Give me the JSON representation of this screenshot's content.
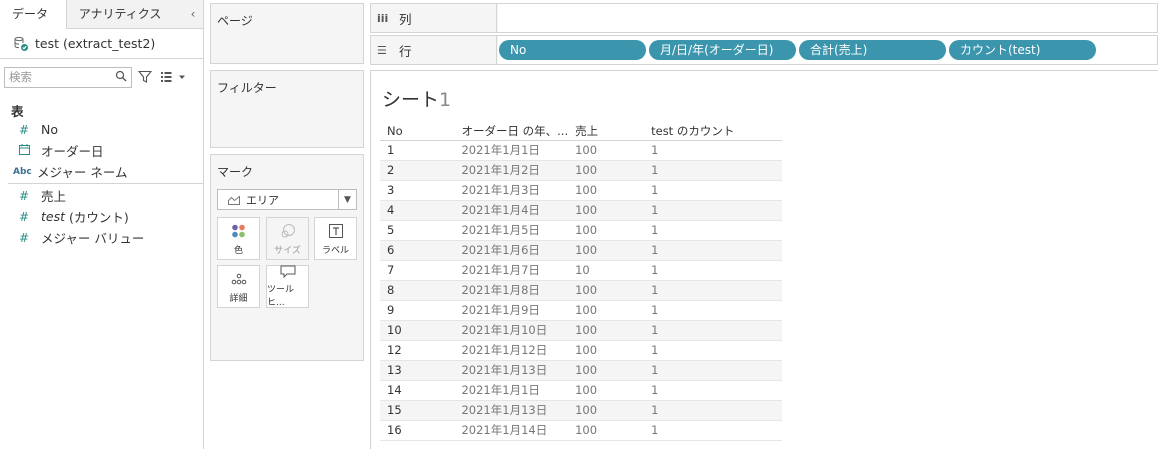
{
  "data_pane": {
    "tab_data": "データ",
    "tab_analytics": "アナリティクス",
    "collapse_glyph": "‹",
    "datasource_name": "test (extract_test2)",
    "search_placeholder": "検索",
    "section_table": "表",
    "fields": [
      {
        "label": "No",
        "icon": "#",
        "type": "measure-number"
      },
      {
        "label": "オーダー日",
        "icon": "date-icon",
        "type": "date"
      },
      {
        "label": "メジャー ネーム",
        "icon": "Abc",
        "type": "string"
      }
    ],
    "measures": [
      {
        "label": "売上",
        "icon": "#",
        "italic": false
      },
      {
        "label_italic": "test",
        "label_suffix": " (カウント)",
        "icon": "#",
        "italic": true
      },
      {
        "label": "メジャー バリュー",
        "icon": "#",
        "italic": false
      }
    ]
  },
  "cards": {
    "pages_title": "ページ",
    "filters_title": "フィルター",
    "marks_title": "マーク",
    "mark_type": "エリア",
    "mark_buttons": {
      "color": "色",
      "size": "サイズ",
      "label": "ラベル",
      "detail": "詳細",
      "tooltip": "ツールヒ..."
    }
  },
  "shelves": {
    "columns_label": "列",
    "rows_label": "行",
    "row_pills": [
      "No",
      "月/日/年(オーダー日)",
      "合計(売上)",
      "カウント(test)"
    ]
  },
  "sheet": {
    "title_text": "シート",
    "title_num": "1",
    "headers": [
      "No",
      "オーダー日 の年、...",
      "売上",
      "test のカウント"
    ],
    "rows": [
      [
        "1",
        "2021年1月1日",
        "100",
        "1"
      ],
      [
        "2",
        "2021年1月2日",
        "100",
        "1"
      ],
      [
        "3",
        "2021年1月3日",
        "100",
        "1"
      ],
      [
        "4",
        "2021年1月4日",
        "100",
        "1"
      ],
      [
        "5",
        "2021年1月5日",
        "100",
        "1"
      ],
      [
        "6",
        "2021年1月6日",
        "100",
        "1"
      ],
      [
        "7",
        "2021年1月7日",
        "10",
        "1"
      ],
      [
        "8",
        "2021年1月8日",
        "100",
        "1"
      ],
      [
        "9",
        "2021年1月9日",
        "100",
        "1"
      ],
      [
        "10",
        "2021年1月10日",
        "100",
        "1"
      ],
      [
        "12",
        "2021年1月12日",
        "100",
        "1"
      ],
      [
        "13",
        "2021年1月13日",
        "100",
        "1"
      ],
      [
        "14",
        "2021年1月1日",
        "100",
        "1"
      ],
      [
        "15",
        "2021年1月13日",
        "100",
        "1"
      ],
      [
        "16",
        "2021年1月14日",
        "100",
        "1"
      ]
    ]
  },
  "colors": {
    "pill": "#3a95ad",
    "field_icon": "#2a8c84",
    "string_icon": "#3e6f91"
  }
}
